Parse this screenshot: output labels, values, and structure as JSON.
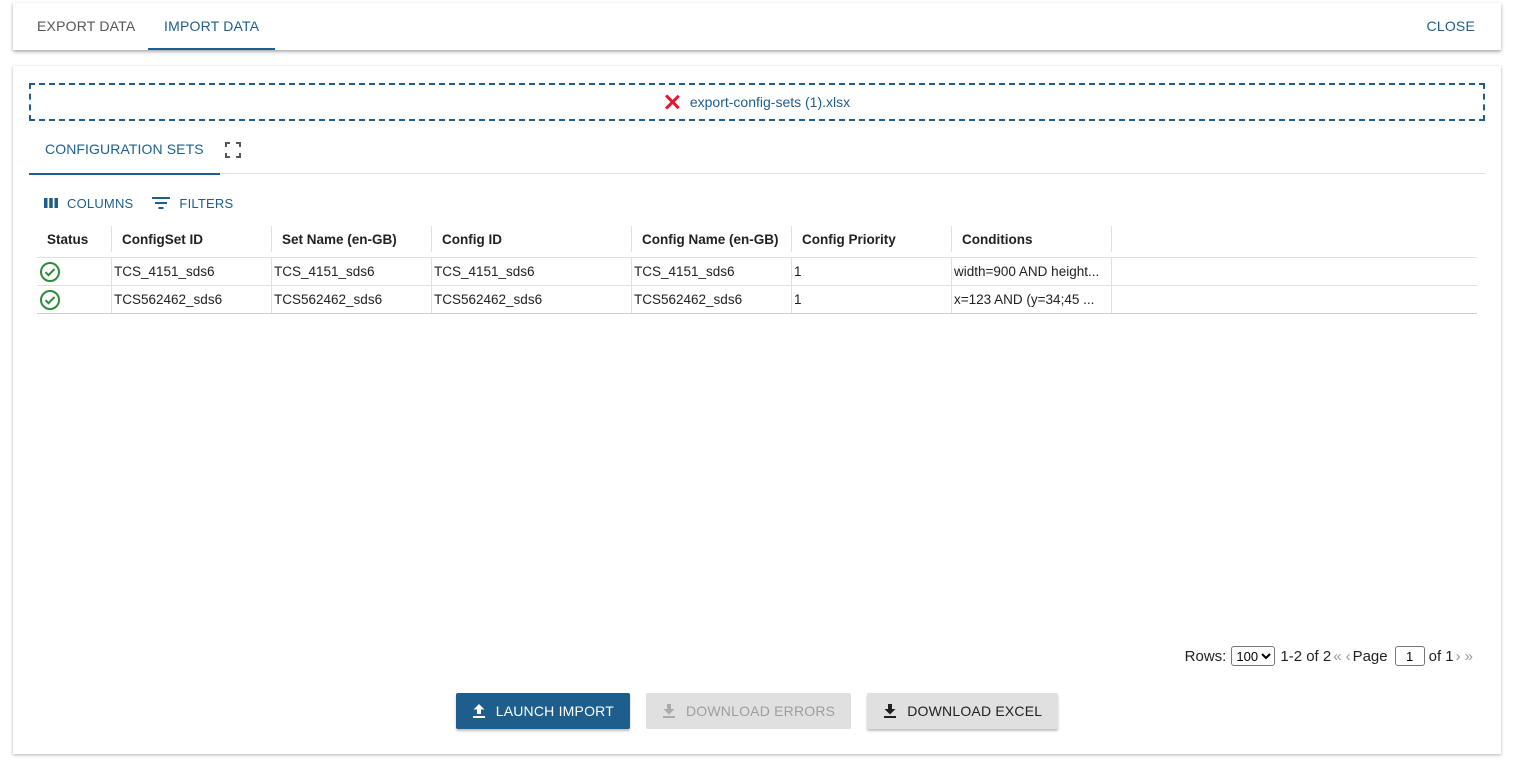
{
  "top_tabs": {
    "export": "EXPORT DATA",
    "import": "IMPORT DATA",
    "close": "CLOSE"
  },
  "dropzone": {
    "filename": "export-config-sets (1).xlsx"
  },
  "sub_tabs": {
    "config_sets": "CONFIGURATION SETS"
  },
  "toolbar": {
    "columns": "COLUMNS",
    "filters": "FILTERS"
  },
  "grid": {
    "headers": [
      "Status",
      "ConfigSet ID",
      "Set Name (en-GB)",
      "Config ID",
      "Config Name (en-GB)",
      "Config Priority",
      "Conditions"
    ],
    "rows": [
      {
        "status": "ok",
        "configset_id": "TCS_4151_sds6",
        "set_name": "TCS_4151_sds6",
        "config_id": "TCS_4151_sds6",
        "config_name": "TCS_4151_sds6",
        "priority": "1",
        "conditions": "width=900 AND height..."
      },
      {
        "status": "ok",
        "configset_id": "TCS562462_sds6",
        "set_name": "TCS562462_sds6",
        "config_id": "TCS562462_sds6",
        "config_name": "TCS562462_sds6",
        "priority": "1",
        "conditions": "x=123 AND (y=34;45 ..."
      }
    ]
  },
  "pager": {
    "rows_label": "Rows:",
    "rows_value": "100",
    "range": "1-2 of 2",
    "page_label": "Page",
    "page_value": "1",
    "of_label": "of 1"
  },
  "actions": {
    "launch": "LAUNCH IMPORT",
    "errors": "DOWNLOAD ERRORS",
    "excel": "DOWNLOAD EXCEL"
  },
  "colors": {
    "accent": "#1d5e8c",
    "success": "#2e8b3a",
    "danger": "#e0192e"
  }
}
